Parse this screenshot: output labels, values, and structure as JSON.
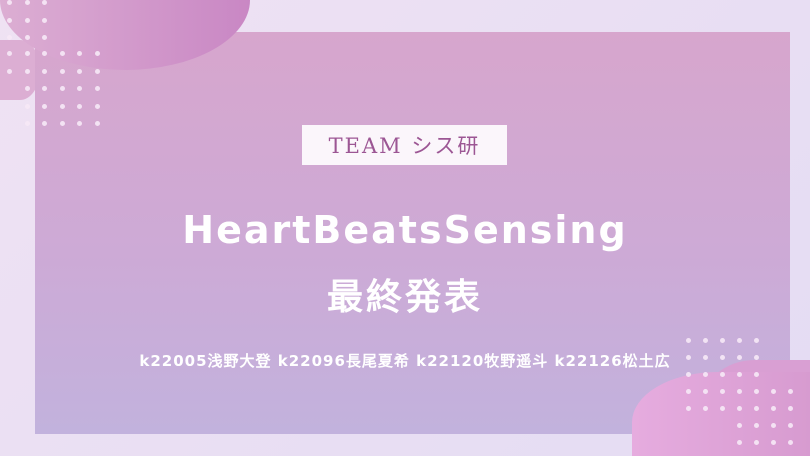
{
  "slide": {
    "team_label": "TEAM シス研",
    "title": "HeartBeatsSensing",
    "subtitle": "最終発表",
    "members": "k22005浅野大登 k22096長尾夏希 k22120牧野遥斗 k22126松土広"
  },
  "colors": {
    "accent": "#9c5694",
    "panel_top": "#d7a6cd",
    "panel_bottom": "#c2b2dd"
  }
}
